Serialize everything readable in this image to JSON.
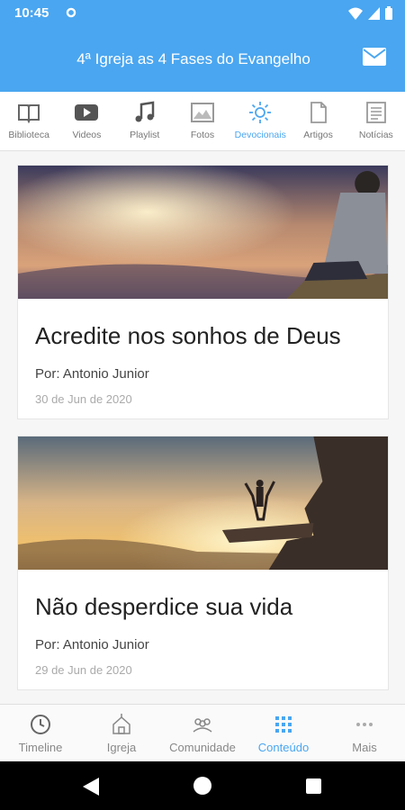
{
  "status_bar": {
    "time": "10:45"
  },
  "app_bar": {
    "title": "4ª Igreja as 4 Fases do Evangelho"
  },
  "category_tabs": [
    {
      "label": "Biblioteca",
      "icon": "book-icon"
    },
    {
      "label": "Videos",
      "icon": "play-icon"
    },
    {
      "label": "Playlist",
      "icon": "music-note-icon"
    },
    {
      "label": "Fotos",
      "icon": "photo-icon"
    },
    {
      "label": "Devocionais",
      "icon": "sun-icon",
      "active": true
    },
    {
      "label": "Artigos",
      "icon": "document-icon"
    },
    {
      "label": "Notícias",
      "icon": "news-icon"
    }
  ],
  "posts": [
    {
      "title": "Acredite nos sonhos de Deus",
      "author": "Por: Antonio Junior",
      "date": "30 de Jun de 2020"
    },
    {
      "title": "Não desperdice sua vida",
      "author": "Por: Antonio Junior",
      "date": "29 de Jun de 2020"
    }
  ],
  "bottom_nav": [
    {
      "label": "Timeline",
      "icon": "clock-icon"
    },
    {
      "label": "Igreja",
      "icon": "church-icon"
    },
    {
      "label": "Comunidade",
      "icon": "people-icon"
    },
    {
      "label": "Conteúdo",
      "icon": "grid-icon",
      "active": true
    },
    {
      "label": "Mais",
      "icon": "more-icon"
    }
  ],
  "colors": {
    "primary": "#4aa6f0",
    "inactive": "#777777"
  }
}
